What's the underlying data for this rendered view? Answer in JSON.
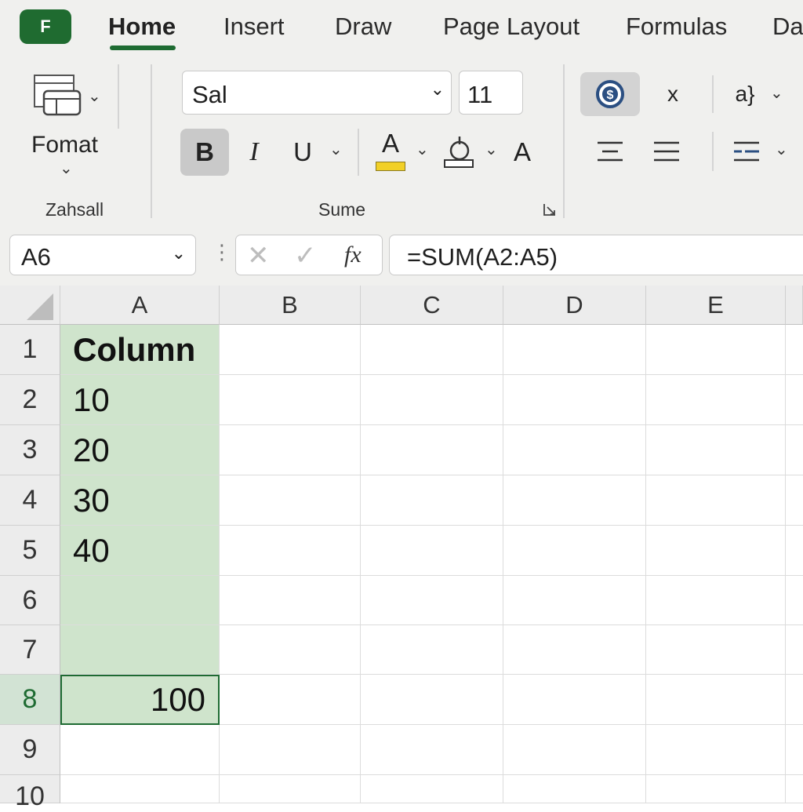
{
  "app": {
    "logo_letter": "F"
  },
  "tabs": [
    "Home",
    "Insert",
    "Draw",
    "Page Layout",
    "Formulas",
    "Da"
  ],
  "ribbon": {
    "group1_button": "Fomat",
    "group1_label": "Zahsall",
    "font_name": "Sal",
    "font_size": "11",
    "bold": "B",
    "italic": "I",
    "underline": "U",
    "font_color_glyph": "A",
    "grow_font_glyph": "A",
    "clear_glyph": "x",
    "wrap_glyph": "a}",
    "group2_label": "Sume",
    "colors": {
      "accent": "#1e6b32",
      "highlight_yellow": "#f2d027",
      "selection_green": "#cfe4cc"
    }
  },
  "formula_bar": {
    "name_box": "A6",
    "fx": "fx",
    "formula": "=SUM(A2:A5)"
  },
  "grid": {
    "columns": [
      "A",
      "B",
      "C",
      "D",
      "E"
    ],
    "rows": [
      "1",
      "2",
      "3",
      "4",
      "5",
      "6",
      "7",
      "8",
      "9",
      "10"
    ],
    "cells": {
      "A1": "Column",
      "A2": "10",
      "A3": "20",
      "A4": "30",
      "A5": "40",
      "A8": "100"
    },
    "selected_row": "8"
  }
}
